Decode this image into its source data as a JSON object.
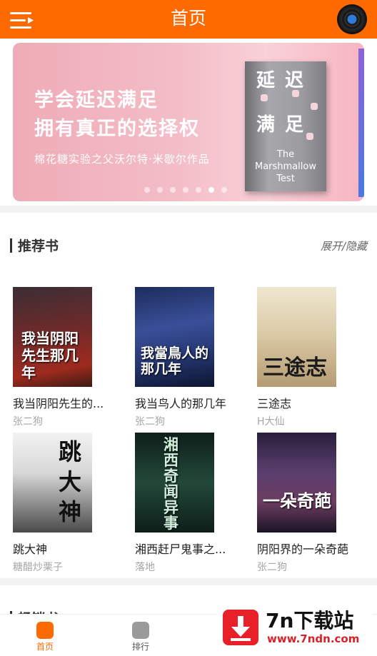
{
  "header": {
    "title": "首页",
    "menu_icon": "menu-icon",
    "avatar_icon": "vinyl-record-icon",
    "accent_color": "#fe6a00"
  },
  "banner": {
    "line1": "学会延迟满足",
    "line2": "拥有真正的选择权",
    "subtitle": "棉花糖实验之父沃尔特·米歇尔作品",
    "book": {
      "title_top": "延迟",
      "title_bottom": "满足",
      "title_en_1": "The",
      "title_en_2": "Marshmallow",
      "title_en_3": "Test"
    },
    "dot_count": 7,
    "active_dot": 6
  },
  "recommend": {
    "title": "推荐书",
    "toggle_label": "展开/隐藏",
    "books": [
      {
        "title": "我当阴阳先生的...",
        "author": "张二狗",
        "cover_text": "我当阴阳先生那几年"
      },
      {
        "title": "我当鸟人的那几年",
        "author": "张二狗",
        "cover_text": "我當鳥人的那几年"
      },
      {
        "title": "三途志",
        "author": "H大仙",
        "cover_text": "三途志"
      },
      {
        "title": "跳大神",
        "author": "糖醋炒栗子",
        "cover_text": "跳大神"
      },
      {
        "title": "湘西赶尸鬼事之...",
        "author": "落地",
        "cover_text": "湘西奇闻异事"
      },
      {
        "title": "阴阳界的一朵奇葩",
        "author": "张二狗",
        "cover_text": "一朵奇葩"
      }
    ]
  },
  "next_section": {
    "title": "畅销书"
  },
  "bottom_nav": {
    "home_label": "首页",
    "rank_label": "排行",
    "home_icon": "home-icon",
    "rank_icon": "rank-icon"
  },
  "watermark": {
    "big": "7n下载站",
    "small": "www.7ndn.com",
    "icon": "download-arrow-icon"
  }
}
